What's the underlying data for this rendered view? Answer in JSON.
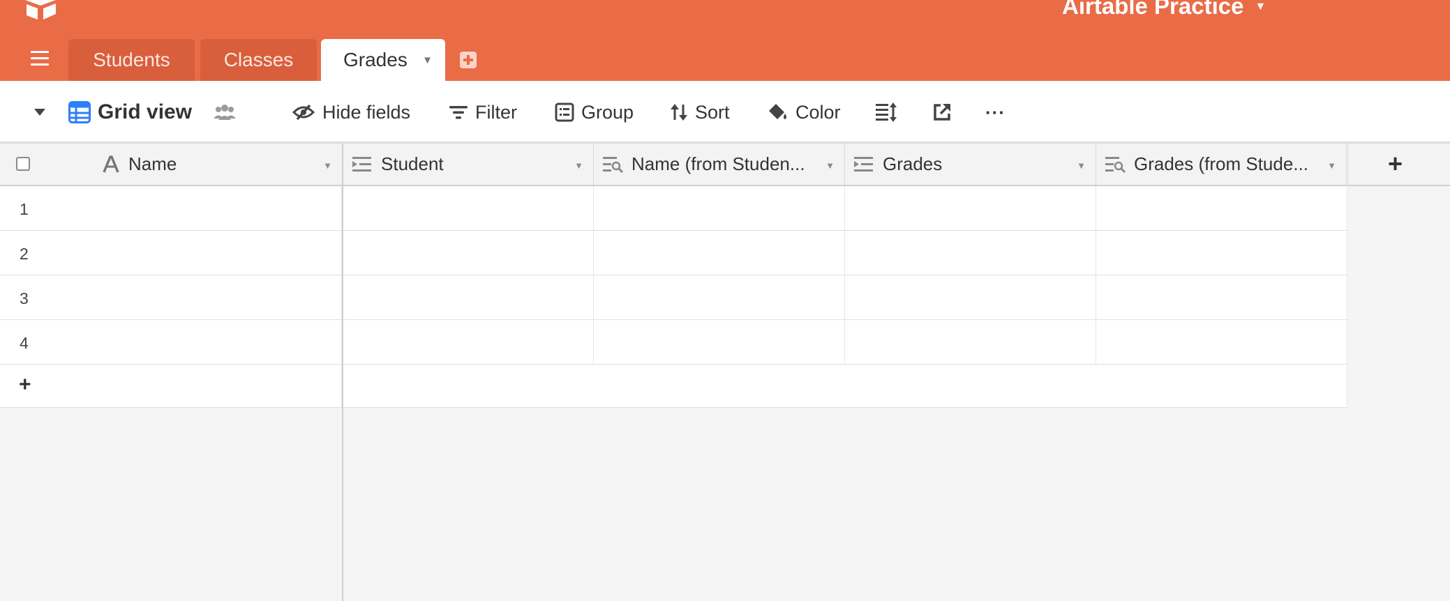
{
  "app": {
    "base_name": "Airtable Practice",
    "colors": {
      "header": "#e96c47",
      "tab_inactive": "#d95e3c",
      "view_icon": "#2d7ff9"
    }
  },
  "tabs": [
    {
      "label": "Students",
      "active": false
    },
    {
      "label": "Classes",
      "active": false
    },
    {
      "label": "Grades",
      "active": true
    }
  ],
  "toolbar": {
    "view_name": "Grid view",
    "hide_fields": "Hide fields",
    "filter": "Filter",
    "group": "Group",
    "sort": "Sort",
    "color": "Color",
    "more": "···"
  },
  "columns": [
    {
      "label": "Name",
      "icon": "text-field-icon"
    },
    {
      "label": "Student",
      "icon": "link-field-icon"
    },
    {
      "label": "Name (from Studen...",
      "icon": "lookup-field-icon"
    },
    {
      "label": "Grades",
      "icon": "link-field-icon"
    },
    {
      "label": "Grades (from Stude...",
      "icon": "lookup-field-icon"
    }
  ],
  "rows": [
    "1",
    "2",
    "3",
    "4"
  ],
  "add_row_label": "+",
  "add_field_label": "+"
}
